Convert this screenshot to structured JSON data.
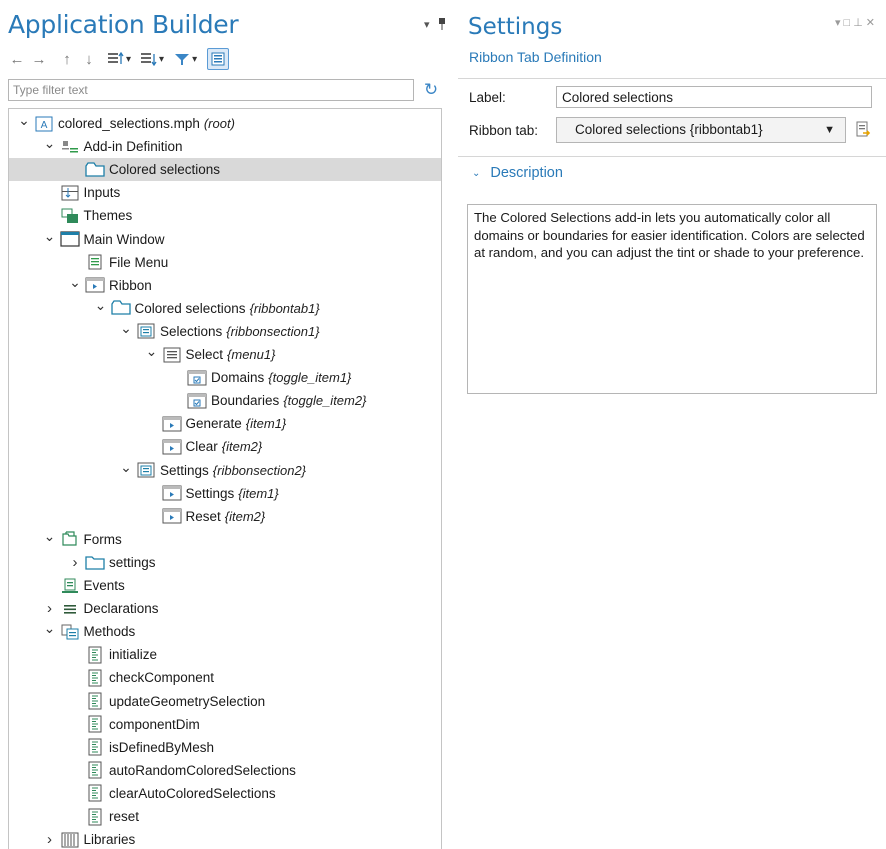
{
  "builder": {
    "title": "Application Builder",
    "filter_placeholder": "Type filter text",
    "tree": [
      {
        "label": "colored_selections.mph",
        "tag": "(root)",
        "icon": "app-icon",
        "exp": "open"
      },
      {
        "label": "Add-in Definition",
        "tag": "",
        "icon": "addin-icon",
        "exp": "open"
      },
      {
        "label": "Colored selections",
        "tag": "",
        "icon": "ribbontab-icon",
        "exp": "",
        "selected": true
      },
      {
        "label": "Inputs",
        "tag": "",
        "icon": "inputs-icon",
        "exp": ""
      },
      {
        "label": "Themes",
        "tag": "",
        "icon": "themes-icon",
        "exp": ""
      },
      {
        "label": "Main Window",
        "tag": "",
        "icon": "window-icon",
        "exp": "open"
      },
      {
        "label": "File Menu",
        "tag": "",
        "icon": "filemenu-icon",
        "exp": ""
      },
      {
        "label": "Ribbon",
        "tag": "",
        "icon": "item-icon",
        "exp": "open"
      },
      {
        "label": "Colored selections",
        "tag": "{ribbontab1}",
        "icon": "ribbontab-icon",
        "exp": "open"
      },
      {
        "label": "Selections",
        "tag": "{ribbonsection1}",
        "icon": "section-icon",
        "exp": "open"
      },
      {
        "label": "Select",
        "tag": "{menu1}",
        "icon": "menu-icon",
        "exp": "open"
      },
      {
        "label": "Domains",
        "tag": "{toggle_item1}",
        "icon": "toggle-icon",
        "exp": ""
      },
      {
        "label": "Boundaries",
        "tag": "{toggle_item2}",
        "icon": "toggle-icon",
        "exp": ""
      },
      {
        "label": "Generate",
        "tag": "{item1}",
        "icon": "item-icon",
        "exp": ""
      },
      {
        "label": "Clear",
        "tag": "{item2}",
        "icon": "item-icon",
        "exp": ""
      },
      {
        "label": "Settings",
        "tag": "{ribbonsection2}",
        "icon": "section-icon",
        "exp": "open"
      },
      {
        "label": "Settings",
        "tag": "{item1}",
        "icon": "item-icon",
        "exp": ""
      },
      {
        "label": "Reset",
        "tag": "{item2}",
        "icon": "item-icon",
        "exp": ""
      },
      {
        "label": "Forms",
        "tag": "",
        "icon": "forms-icon",
        "exp": "open"
      },
      {
        "label": "settings",
        "tag": "",
        "icon": "form-icon",
        "exp": "closed"
      },
      {
        "label": "Events",
        "tag": "",
        "icon": "events-icon",
        "exp": ""
      },
      {
        "label": "Declarations",
        "tag": "",
        "icon": "declarations-icon",
        "exp": "closed"
      },
      {
        "label": "Methods",
        "tag": "",
        "icon": "methods-icon",
        "exp": "open"
      },
      {
        "label": "initialize",
        "tag": "",
        "icon": "method-icon",
        "exp": ""
      },
      {
        "label": "checkComponent",
        "tag": "",
        "icon": "method-icon",
        "exp": ""
      },
      {
        "label": "updateGeometrySelection",
        "tag": "",
        "icon": "method-icon",
        "exp": ""
      },
      {
        "label": "componentDim",
        "tag": "",
        "icon": "method-icon",
        "exp": ""
      },
      {
        "label": "isDefinedByMesh",
        "tag": "",
        "icon": "method-icon",
        "exp": ""
      },
      {
        "label": "autoRandomColoredSelections",
        "tag": "",
        "icon": "method-icon",
        "exp": ""
      },
      {
        "label": "clearAutoColoredSelections",
        "tag": "",
        "icon": "method-icon",
        "exp": ""
      },
      {
        "label": "reset",
        "tag": "",
        "icon": "method-icon",
        "exp": ""
      },
      {
        "label": "Libraries",
        "tag": "",
        "icon": "libraries-icon",
        "exp": "closed"
      }
    ]
  },
  "settings": {
    "title": "Settings",
    "subtitle": "Ribbon Tab Definition",
    "label_caption": "Label:",
    "label_value": "Colored selections",
    "ribbon_tab_caption": "Ribbon tab:",
    "ribbon_tab_value": "Colored selections {ribbontab1}",
    "description_heading": "Description",
    "description_text": "The Colored Selections add-in lets you automatically color all domains or boundaries for easier identification. Colors are selected at random, and you can adjust the tint or shade to your preference."
  },
  "colors": {
    "accent": "#2a7ab8",
    "selection": "#d9d9d9"
  }
}
